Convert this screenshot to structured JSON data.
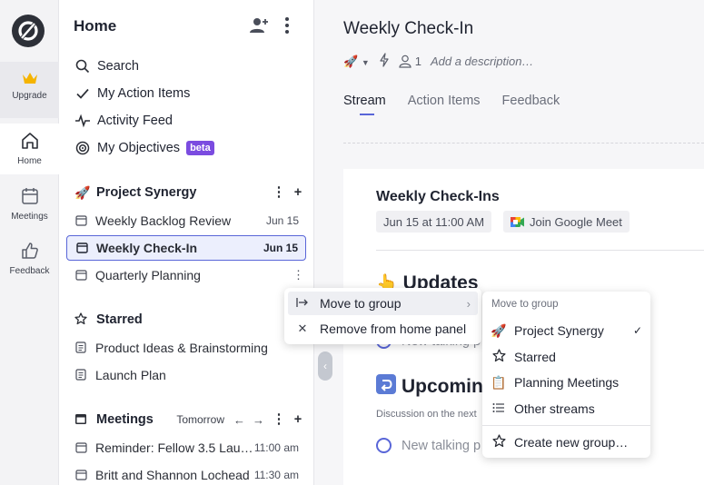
{
  "rail": {
    "upgrade_label": "Upgrade",
    "home_label": "Home",
    "meetings_label": "Meetings",
    "feedback_label": "Feedback"
  },
  "sidebar": {
    "title": "Home",
    "nav": [
      {
        "label": "Search",
        "icon": "search-icon"
      },
      {
        "label": "My Action Items",
        "icon": "check-icon"
      },
      {
        "label": "Activity Feed",
        "icon": "pulse-icon"
      },
      {
        "label": "My Objectives",
        "icon": "target-icon",
        "badge": "beta"
      }
    ],
    "project": {
      "name": "Project Synergy",
      "emoji": "🚀",
      "items": [
        {
          "name": "Weekly Backlog Review",
          "date": "Jun 15"
        },
        {
          "name": "Weekly Check-In",
          "date": "Jun 15"
        },
        {
          "name": "Quarterly Planning",
          "date": ""
        }
      ]
    },
    "starred": {
      "name": "Starred",
      "items": [
        {
          "name": "Product Ideas & Brainstorming"
        },
        {
          "name": "Launch Plan"
        }
      ]
    },
    "meetings": {
      "name": "Meetings",
      "day": "Tomorrow",
      "items": [
        {
          "name": "Reminder: Fellow 3.5 Lau…",
          "time": "11:00 am"
        },
        {
          "name": "Britt and Shannon Lochead",
          "time": "11:30 am"
        }
      ]
    }
  },
  "main": {
    "title": "Weekly Check-In",
    "emoji": "🚀",
    "attendees_count": "1",
    "description_placeholder": "Add a description…",
    "tabs": [
      "Stream",
      "Action Items",
      "Feedback"
    ],
    "card": {
      "title": "Weekly Check-Ins",
      "date_chip": "Jun 15 at 11:00 AM",
      "meet_chip": "Join Google Meet",
      "updates_emoji": "👆",
      "updates_heading": "Updates",
      "new_talking_1": "New talking p",
      "upcoming_emoji": "↪️",
      "upcoming_heading": "Upcoming",
      "discussion_text": "Discussion on the next",
      "new_talking_2": "New talking p"
    }
  },
  "context_menu": {
    "items": [
      {
        "label": "Move to group",
        "icon": "move-icon"
      },
      {
        "label": "Remove from home panel",
        "icon": "close-icon"
      }
    ]
  },
  "group_menu": {
    "heading": "Move to group",
    "items": [
      {
        "label": "Project Synergy",
        "emoji": "🚀",
        "checked": true
      },
      {
        "label": "Starred",
        "icon": "star-icon"
      },
      {
        "label": "Planning Meetings",
        "emoji": "📋"
      },
      {
        "label": "Other streams",
        "icon": "list-icon"
      }
    ],
    "create_label": "Create new group…"
  },
  "colors": {
    "accent": "#5966d8",
    "beta": "#7b4ce0",
    "crown": "#f5b400"
  }
}
